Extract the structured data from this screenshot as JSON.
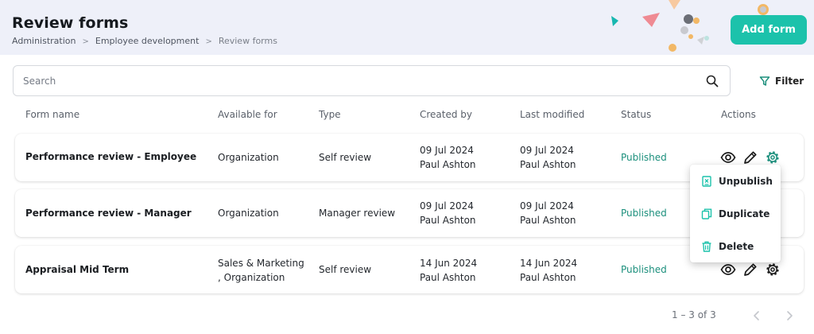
{
  "header": {
    "title": "Review forms",
    "breadcrumb": [
      "Administration",
      "Employee development",
      "Review forms"
    ],
    "add_button_label": "Add form",
    "accent_color": "#1cc2ab"
  },
  "search": {
    "placeholder": "Search",
    "value": ""
  },
  "filter": {
    "label": "Filter",
    "icon": "funnel-icon"
  },
  "table": {
    "columns": [
      "Form name",
      "Available for",
      "Type",
      "Created by",
      "Last modified",
      "Status",
      "Actions"
    ],
    "rows": [
      {
        "name": "Performance review - Employee",
        "available_for": [
          "Organization"
        ],
        "type": "Self review",
        "created_date": "09 Jul 2024",
        "created_by": "Paul Ashton",
        "modified_date": "09 Jul 2024",
        "modified_by": "Paul Ashton",
        "status": "Published"
      },
      {
        "name": "Performance review - Manager",
        "available_for": [
          "Organization"
        ],
        "type": "Manager review",
        "created_date": "09 Jul 2024",
        "created_by": "Paul Ashton",
        "modified_date": "09 Jul 2024",
        "modified_by": "Paul Ashton",
        "status": "Published"
      },
      {
        "name": "Appraisal Mid Term",
        "available_for": [
          "Sales & Marketing",
          ", Organization"
        ],
        "type": "Self review",
        "created_date": "14 Jun 2024",
        "created_by": "Paul Ashton",
        "modified_date": "14 Jun 2024",
        "modified_by": "Paul Ashton",
        "status": "Published"
      }
    ],
    "status_color": "#1b8f7c",
    "actions_icons": [
      "eye-icon",
      "pencil-icon",
      "gear-icon"
    ]
  },
  "context_menu": {
    "items": [
      {
        "label": "Unpublish",
        "icon": "unpublish-icon"
      },
      {
        "label": "Duplicate",
        "icon": "copy-icon"
      },
      {
        "label": "Delete",
        "icon": "trash-icon"
      }
    ],
    "icon_color": "#1cc2ab"
  },
  "pagination": {
    "range": "1 – 3 of 3"
  }
}
